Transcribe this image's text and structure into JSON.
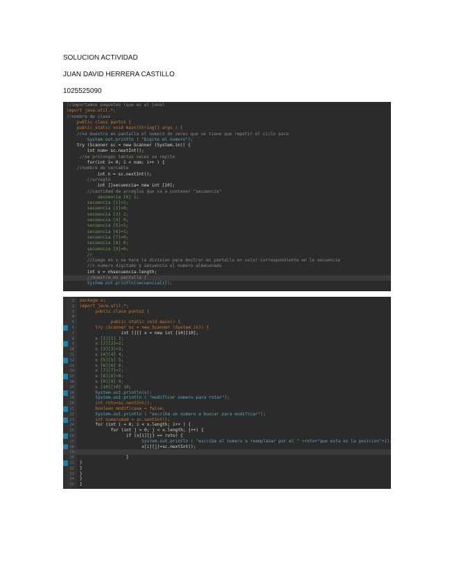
{
  "header": {
    "title": "SOLUCION ACTIVIDAD",
    "author": "JUAN DAVID HERRERA CASTILLO",
    "id": "1025525090"
  },
  "code1": [
    {
      "t": "//importamos paquetes (que es el java)",
      "k": "comment"
    },
    {
      "t": "import java.util.*;",
      "k": "kw"
    },
    {
      "t": "//nombre de clase",
      "k": "comment"
    },
    {
      "t": "    public class punto1 {",
      "k": "kw"
    },
    {
      "t": "    public static void main(String[] args ) {",
      "k": "kw"
    },
    {
      "t": "    //se muestra en pantalla el numero de veces que se tiene que repetir el ciclo para",
      "k": "comment"
    },
    {
      "t": "        System.out.println ( \"Digite el numero\");",
      "k": "str"
    },
    {
      "t": "    try (Scanner sc = new Scanner (System.in)) {",
      "k": "code"
    },
    {
      "t": "        int num= sc.nextInt();",
      "k": "code"
    },
    {
      "t": "     //se prolongan tantas veces se repite",
      "k": "comment"
    },
    {
      "t": "        for(int i= 0; i < num; i++ ) {",
      "k": "code"
    },
    {
      "t": "    //nombre de variable",
      "k": "comment"
    },
    {
      "t": "            int n = sc.nextInt();",
      "k": "code"
    },
    {
      "t": "        //arreglo",
      "k": "comment"
    },
    {
      "t": "            int []secuencia= new int [10];",
      "k": "code"
    },
    {
      "t": "        //cantidad de arreglos que va a contener \"secuencia\"",
      "k": "comment"
    },
    {
      "t": "            secuencia [0] 1;",
      "k": "arr"
    },
    {
      "t": "        secuencia [1]=1;",
      "k": "arr"
    },
    {
      "t": "        secuencia [2]=0;",
      "k": "arr"
    },
    {
      "t": "        secuencia [3] 1;",
      "k": "arr"
    },
    {
      "t": "        secuencia [4] 0;",
      "k": "arr"
    },
    {
      "t": "        secuencia [5]=1;",
      "k": "arr"
    },
    {
      "t": "        secuencia [6]=1;",
      "k": "arr"
    },
    {
      "t": "        secuencia [7]=0;",
      "k": "arr"
    },
    {
      "t": "        secuencia [8] 0;",
      "k": "arr"
    },
    {
      "t": "        secuencia [9]=0;",
      "k": "arr"
    },
    {
      "t": "        //",
      "k": "comment"
    },
    {
      "t": "        //luego en x se hace la division para mostrar en pantalla en valor correspondiente en la secuencia",
      "k": "comment"
    },
    {
      "t": "        //n numero digitado y secuencia el numero almacenado",
      "k": "comment"
    },
    {
      "t": "        int x = n%secuencia.length;",
      "k": "code"
    },
    {
      "t": "        //muestra en pantalla |",
      "k": "comment",
      "hl": true
    },
    {
      "t": "        System.out.println(secuencia[x]);",
      "k": "str"
    }
  ],
  "code2": [
    {
      "n": "1",
      "t": "package x;",
      "k": "kw"
    },
    {
      "n": "2",
      "t": "import java.util.*;",
      "k": "kw"
    },
    {
      "n": "3",
      "t": "      public class punto2 {",
      "k": "kw"
    },
    {
      "n": "4",
      "t": "",
      "k": "code"
    },
    {
      "n": "5",
      "t": "            public static void main() {",
      "k": "kw"
    },
    {
      "n": "6",
      "t": "      try (Scanner sc = new Scanner (System.in)) {",
      "k": "kw",
      "m": true
    },
    {
      "n": "7",
      "t": "                int [][] x = new int [10][10];",
      "k": "code"
    },
    {
      "n": "8",
      "t": "      x [1][1] 1;",
      "k": "arr"
    },
    {
      "n": "9",
      "t": "      x [2][2]=2;",
      "k": "arr",
      "m": true
    },
    {
      "n": "10",
      "t": "      x [3][3]=3;",
      "k": "arr"
    },
    {
      "n": "11",
      "t": "      x [4][4] 4;",
      "k": "arr"
    },
    {
      "n": "12",
      "t": "      x [5][5] 5;",
      "k": "arr",
      "m": true
    },
    {
      "n": "13",
      "t": "      x [6][6] 6;",
      "k": "arr"
    },
    {
      "n": "14",
      "t": "      x [7][7]=7;",
      "k": "arr"
    },
    {
      "n": "15",
      "t": "      x [8][8]=8;",
      "k": "arr",
      "m": true
    },
    {
      "n": "16",
      "t": "      x [9][9] 9;",
      "k": "arr"
    },
    {
      "n": "17",
      "t": "      x [10][10] 10;",
      "k": "arr"
    },
    {
      "n": "18",
      "t": "      System.out.println(x);",
      "k": "str",
      "m": true
    },
    {
      "n": "19",
      "t": "      System.out.println ( \"modificar numero para rotar\");",
      "k": "str"
    },
    {
      "n": "20",
      "t": "      int roto=sc.nextInt();",
      "k": "kw"
    },
    {
      "n": "21",
      "t": "      boolean modificase = false;",
      "k": "kw",
      "m": true
    },
    {
      "n": "22",
      "t": "      System.out.println ( \"escriba un numero a buscar para modificar\");",
      "k": "str"
    },
    {
      "n": "23",
      "t": "      int numeromod = sc.nextInt();",
      "k": "kw",
      "m": true
    },
    {
      "n": "24",
      "t": "      for (int i = 0; i < x.length; i++ ) {",
      "k": "code"
    },
    {
      "n": "25",
      "t": "            for (int j = 0; j < x.length; j++) {",
      "k": "code"
    },
    {
      "n": "26",
      "t": "                  if (x[i][j] == roto) {",
      "k": "code",
      "m": true
    },
    {
      "n": "27",
      "t": "                        System.out.println ( \"escriba el numero a reemplazar por el \" +roto+\"que esta en la posicion\"+i);",
      "k": "str"
    },
    {
      "n": "28",
      "t": "                        x[i][j]=sc.nextInt();",
      "k": "code",
      "m": true
    },
    {
      "n": "29",
      "t": "",
      "k": "code",
      "hl": true
    },
    {
      "n": "30",
      "t": "                  }",
      "k": "code"
    },
    {
      "n": "31",
      "t": "}",
      "k": "code",
      "m": true
    },
    {
      "n": "32",
      "t": "}",
      "k": "code"
    },
    {
      "n": "33",
      "t": "}",
      "k": "code"
    },
    {
      "n": "34",
      "t": "}",
      "k": "code"
    },
    {
      "n": "35",
      "t": "}",
      "k": "code"
    }
  ]
}
